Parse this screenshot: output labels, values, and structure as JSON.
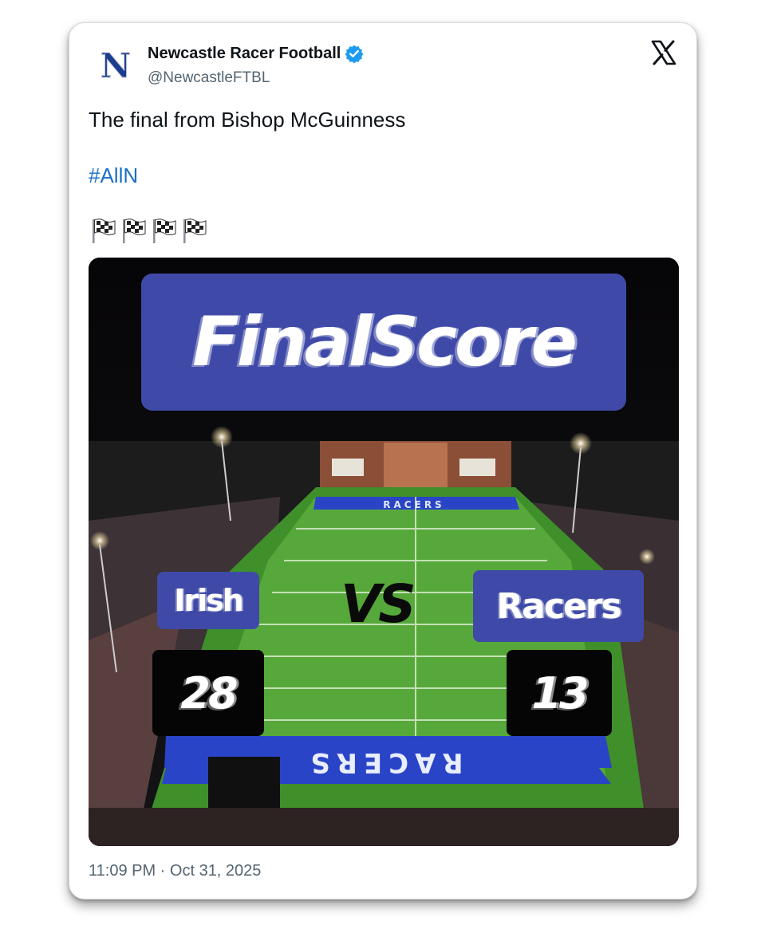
{
  "author": {
    "name": "Newcastle Racer Football",
    "handle": "@NewcastleFTBL",
    "avatar_letter": "N",
    "avatar_color": "#1b3c8f",
    "verified": true,
    "verified_color": "#1d9bf0"
  },
  "platform_icon": "x-logo-icon",
  "tweet": {
    "text": "The final from Bishop McGuinness",
    "hashtag": "#AllN",
    "emoji_icon": "checkered-flag-icon",
    "emoji_count": 4
  },
  "media": {
    "headline": "FinalScore",
    "home_team": "Irish",
    "away_team": "Racers",
    "vs_label": "VS",
    "home_score": "28",
    "away_score": "13",
    "field_text": "RACERS",
    "banner_color": "#3f4aa8",
    "field_blue": "#2a44c8",
    "turf_green": "#3f8f2a"
  },
  "timestamp": "11:09 PM · Oct 31, 2025",
  "colors": {
    "hashtag": "#1d6fc7",
    "secondary_text": "#536471",
    "primary_text": "#0f1419"
  }
}
